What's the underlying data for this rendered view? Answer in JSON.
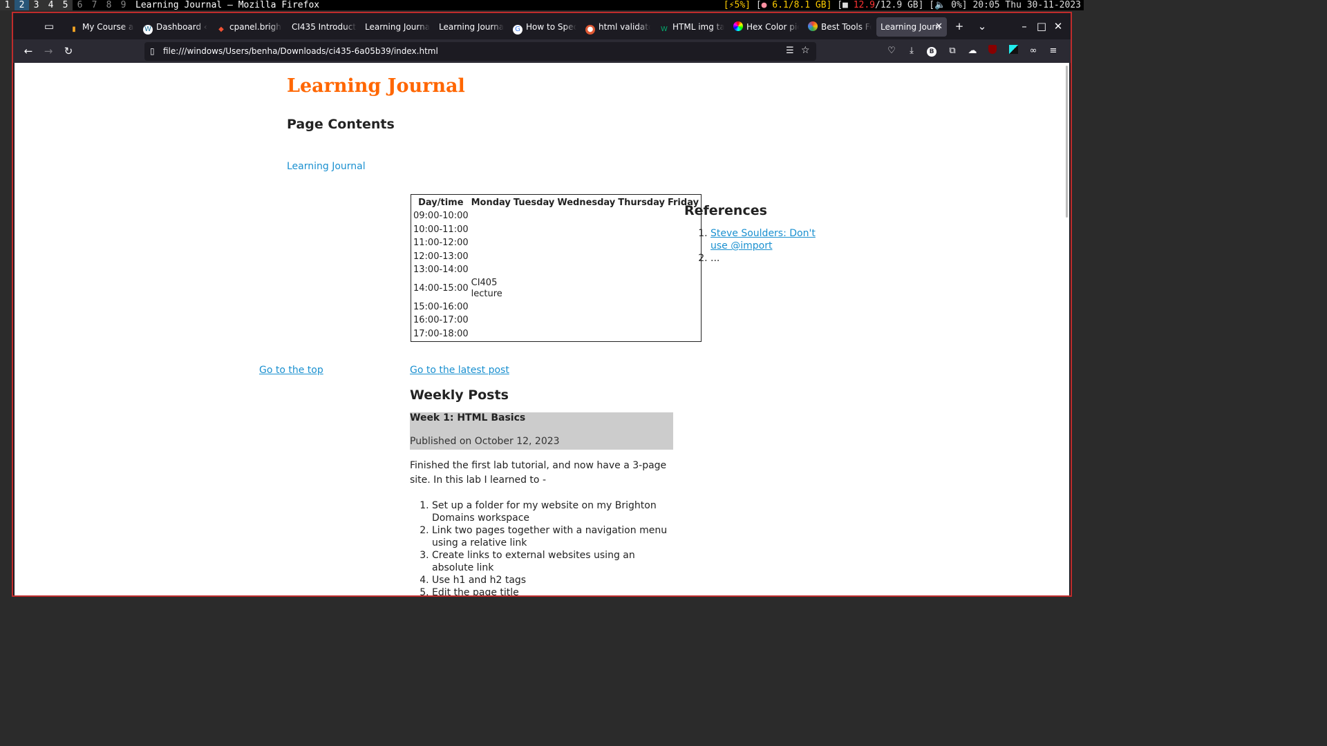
{
  "statusbar": {
    "workspaces": [
      "1",
      "2",
      "3",
      "4",
      "5",
      "6",
      "7",
      "8",
      "9"
    ],
    "window_title": "Learning Journal — Mozilla Firefox",
    "battery": "[⚡5%]",
    "memory_prefix": "[",
    "memory": "6.1/8.1 GB]",
    "disk_prefix": "[",
    "disk_used": "12.9",
    "disk_total": "/12.9 GB]",
    "volume": "[🔈 0%]",
    "datetime": "20:05 Thu 30-11-2023"
  },
  "tabs": [
    {
      "label": "My Course ar",
      "icon": "bar-chart-icon"
    },
    {
      "label": "Dashboard ‹",
      "icon": "wordpress-icon"
    },
    {
      "label": "cpanel.bright",
      "icon": "git-icon"
    },
    {
      "label": "CI435 Introducti",
      "icon": ""
    },
    {
      "label": "Learning Journal",
      "icon": ""
    },
    {
      "label": "Learning Journal",
      "icon": ""
    },
    {
      "label": "How to Speci",
      "icon": "google-icon"
    },
    {
      "label": "html validato",
      "icon": "duckduckgo-icon"
    },
    {
      "label": "HTML img ta",
      "icon": "w3schools-icon"
    },
    {
      "label": "Hex Color pic",
      "icon": "color-wheel-icon"
    },
    {
      "label": "Best Tools Fo",
      "icon": "chrome-web-store-icon"
    },
    {
      "label": "Learning Journ",
      "icon": ""
    }
  ],
  "navbar": {
    "url": "file:///windows/Users/benha/Downloads/ci435-6a05b39/index.html"
  },
  "page": {
    "heading": "Learning Journal",
    "contents_heading": "Page Contents",
    "journal_link": "Learning Journal",
    "timetable": {
      "headers": [
        "Day/time",
        "Monday",
        "Tuesday",
        "Wednesday",
        "Thursday",
        "Friday"
      ],
      "rows": [
        [
          "09:00-10:00",
          "",
          "",
          "",
          "",
          ""
        ],
        [
          "10:00-11:00",
          "",
          "",
          "",
          "",
          ""
        ],
        [
          "11:00-12:00",
          "",
          "",
          "",
          "",
          ""
        ],
        [
          "12:00-13:00",
          "",
          "",
          "",
          "",
          ""
        ],
        [
          "13:00-14:00",
          "",
          "",
          "",
          "",
          ""
        ],
        [
          "14:00-15:00",
          "CI405 lecture",
          "",
          "",
          "",
          ""
        ],
        [
          "15:00-16:00",
          "",
          "",
          "",
          "",
          ""
        ],
        [
          "16:00-17:00",
          "",
          "",
          "",
          "",
          ""
        ],
        [
          "17:00-18:00",
          "",
          "",
          "",
          "",
          ""
        ]
      ]
    },
    "references_heading": "References",
    "references": [
      "Steve Soulders: Don't use @import",
      "..."
    ],
    "top_link": "Go to the top",
    "latest_link": "Go to the latest post",
    "weekly_heading": "Weekly Posts",
    "post": {
      "title": "Week 1: HTML Basics",
      "date": "Published on October 12, 2023",
      "intro": "Finished the first lab tutorial, and now have a 3-page site. In this lab I learned to -",
      "items": [
        "Set up a folder for my website on my Brighton Domains workspace",
        "Link two pages together with a navigation menu using a relative link",
        "Create links to external websites using an absolute link",
        "Use h1 and h2 tags",
        "Edit the page title"
      ]
    }
  },
  "colors": {
    "heading": "#ff6600",
    "link": "#1a90d0",
    "post_box": "#cccccc",
    "frame": "#c02c2c"
  }
}
